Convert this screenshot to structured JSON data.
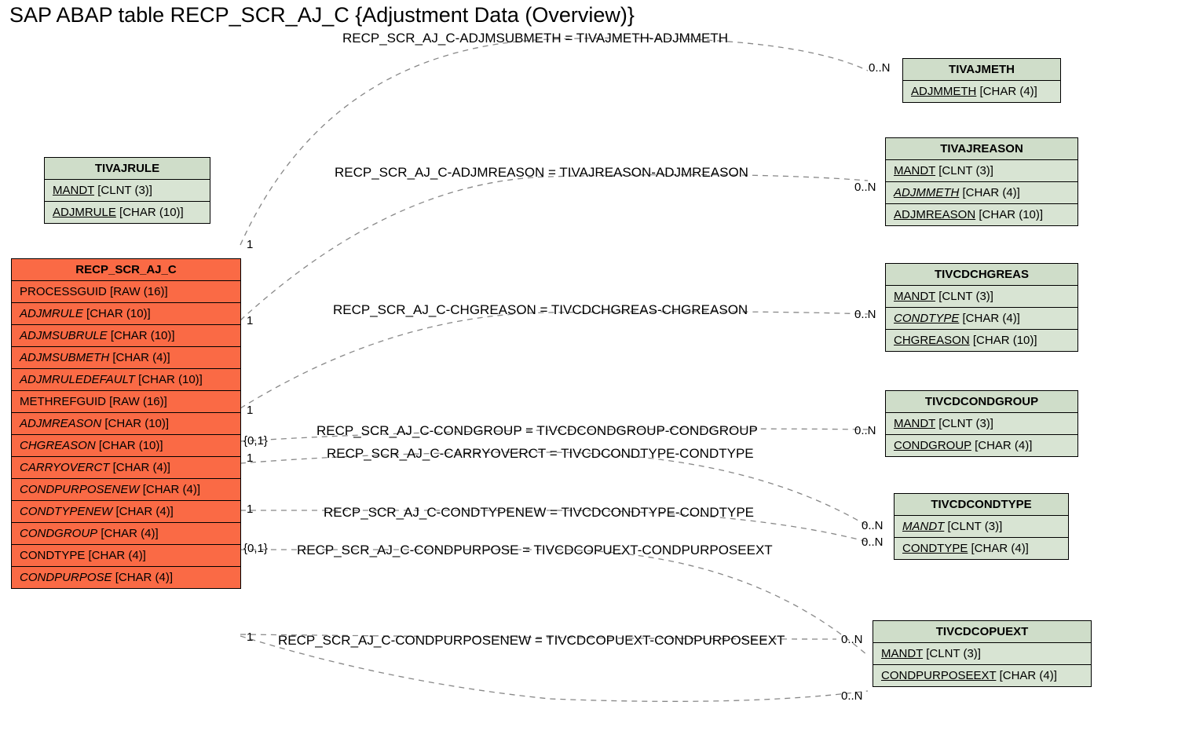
{
  "title": "SAP ABAP table RECP_SCR_AJ_C {Adjustment Data (Overview)}",
  "entities": {
    "tivajrule": {
      "name": "TIVAJRULE",
      "rows": [
        {
          "key": "MANDT",
          "type": "[CLNT (3)]",
          "u": true,
          "i": false
        },
        {
          "key": "ADJMRULE",
          "type": "[CHAR (10)]",
          "u": true,
          "i": false
        }
      ]
    },
    "recp": {
      "name": "RECP_SCR_AJ_C",
      "rows": [
        {
          "key": "PROCESSGUID",
          "type": "[RAW (16)]",
          "u": false,
          "i": false
        },
        {
          "key": "ADJMRULE",
          "type": "[CHAR (10)]",
          "u": false,
          "i": true
        },
        {
          "key": "ADJMSUBRULE",
          "type": "[CHAR (10)]",
          "u": false,
          "i": true
        },
        {
          "key": "ADJMSUBMETH",
          "type": "[CHAR (4)]",
          "u": false,
          "i": true
        },
        {
          "key": "ADJMRULEDEFAULT",
          "type": "[CHAR (10)]",
          "u": false,
          "i": true
        },
        {
          "key": "METHREFGUID",
          "type": "[RAW (16)]",
          "u": false,
          "i": false
        },
        {
          "key": "ADJMREASON",
          "type": "[CHAR (10)]",
          "u": false,
          "i": true
        },
        {
          "key": "CHGREASON",
          "type": "[CHAR (10)]",
          "u": false,
          "i": true
        },
        {
          "key": "CARRYOVERCT",
          "type": "[CHAR (4)]",
          "u": false,
          "i": true
        },
        {
          "key": "CONDPURPOSENEW",
          "type": "[CHAR (4)]",
          "u": false,
          "i": true
        },
        {
          "key": "CONDTYPENEW",
          "type": "[CHAR (4)]",
          "u": false,
          "i": true
        },
        {
          "key": "CONDGROUP",
          "type": "[CHAR (4)]",
          "u": false,
          "i": true
        },
        {
          "key": "CONDTYPE",
          "type": "[CHAR (4)]",
          "u": false,
          "i": false
        },
        {
          "key": "CONDPURPOSE",
          "type": "[CHAR (4)]",
          "u": false,
          "i": true
        }
      ]
    },
    "tivajmeth": {
      "name": "TIVAJMETH",
      "rows": [
        {
          "key": "ADJMMETH",
          "type": "[CHAR (4)]",
          "u": true,
          "i": false
        }
      ]
    },
    "tivajreason": {
      "name": "TIVAJREASON",
      "rows": [
        {
          "key": "MANDT",
          "type": "[CLNT (3)]",
          "u": true,
          "i": false
        },
        {
          "key": "ADJMMETH",
          "type": "[CHAR (4)]",
          "u": true,
          "i": true
        },
        {
          "key": "ADJMREASON",
          "type": "[CHAR (10)]",
          "u": true,
          "i": false
        }
      ]
    },
    "tivcdchgreas": {
      "name": "TIVCDCHGREAS",
      "rows": [
        {
          "key": "MANDT",
          "type": "[CLNT (3)]",
          "u": true,
          "i": false
        },
        {
          "key": "CONDTYPE",
          "type": "[CHAR (4)]",
          "u": true,
          "i": true
        },
        {
          "key": "CHGREASON",
          "type": "[CHAR (10)]",
          "u": true,
          "i": false
        }
      ]
    },
    "tivcdcondgroup": {
      "name": "TIVCDCONDGROUP",
      "rows": [
        {
          "key": "MANDT",
          "type": "[CLNT (3)]",
          "u": true,
          "i": false
        },
        {
          "key": "CONDGROUP",
          "type": "[CHAR (4)]",
          "u": true,
          "i": false
        }
      ]
    },
    "tivcdcondtype": {
      "name": "TIVCDCONDTYPE",
      "rows": [
        {
          "key": "MANDT",
          "type": "[CLNT (3)]",
          "u": true,
          "i": true
        },
        {
          "key": "CONDTYPE",
          "type": "[CHAR (4)]",
          "u": true,
          "i": false
        }
      ]
    },
    "tivcdcopuext": {
      "name": "TIVCDCOPUEXT",
      "rows": [
        {
          "key": "MANDT",
          "type": "[CLNT (3)]",
          "u": true,
          "i": false
        },
        {
          "key": "CONDPURPOSEEXT",
          "type": "[CHAR (4)]",
          "u": true,
          "i": false
        }
      ]
    }
  },
  "relations": {
    "r1": "RECP_SCR_AJ_C-ADJMSUBMETH = TIVAJMETH-ADJMMETH",
    "r2": "RECP_SCR_AJ_C-ADJMREASON = TIVAJREASON-ADJMREASON",
    "r3": "RECP_SCR_AJ_C-CHGREASON = TIVCDCHGREAS-CHGREASON",
    "r4": "RECP_SCR_AJ_C-CONDGROUP = TIVCDCONDGROUP-CONDGROUP",
    "r5": "RECP_SCR_AJ_C-CARRYOVERCT = TIVCDCONDTYPE-CONDTYPE",
    "r6": "RECP_SCR_AJ_C-CONDTYPENEW = TIVCDCONDTYPE-CONDTYPE",
    "r7": "RECP_SCR_AJ_C-CONDPURPOSE = TIVCDCOPUEXT-CONDPURPOSEEXT",
    "r8": "RECP_SCR_AJ_C-CONDPURPOSENEW = TIVCDCOPUEXT-CONDPURPOSEEXT"
  },
  "cards": {
    "c1l": "1",
    "c1r": "0..N",
    "c2l": "1",
    "c2r": "0..N",
    "c3l": "1",
    "c3r": "0..N",
    "c4l": "{0,1}",
    "c4r": "0..N",
    "c5l": "1",
    "c6l": "1",
    "c6r": "0..N",
    "c7l": "{0,1}",
    "c7r": "0..N",
    "c8l": "1",
    "c8r": "0..N",
    "c9r": "0..N"
  }
}
